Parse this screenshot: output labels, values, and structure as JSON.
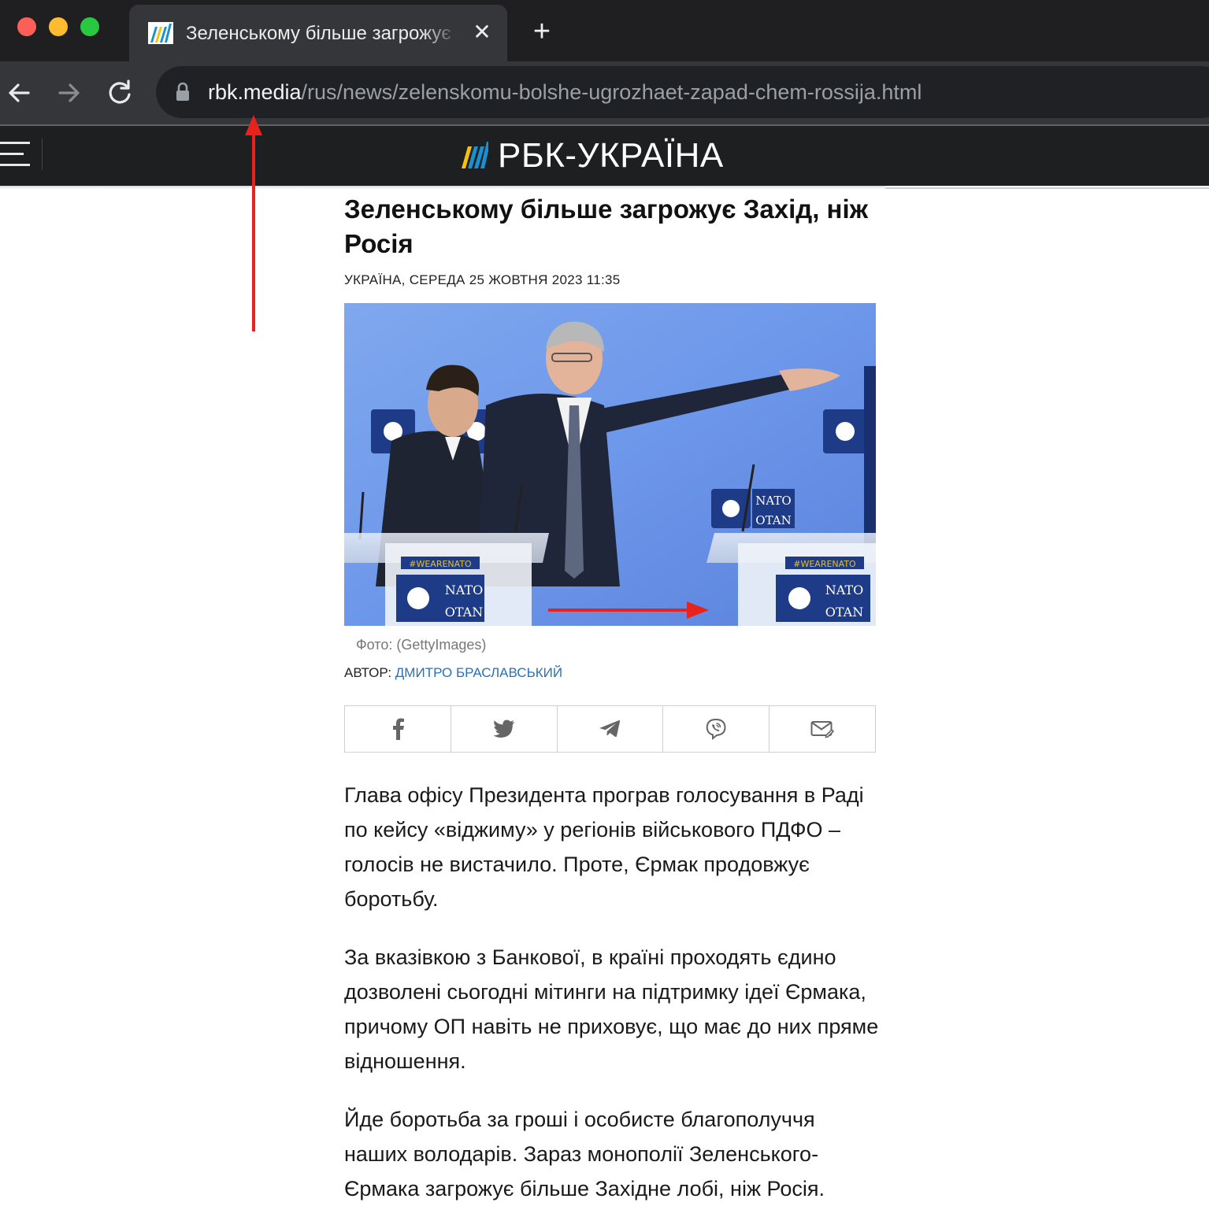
{
  "browser": {
    "tab_title": "Зеленському більше загрожує Захід, ніж Росія",
    "tab_close": "✕",
    "new_tab": "+",
    "url_domain": "rbk.media",
    "url_path": "/rus/news/zelenskomu-bolshe-ugrozhaet-zapad-chem-rossija.html"
  },
  "site": {
    "logo_text": "РБК-УКРАЇНА"
  },
  "article": {
    "headline": "Зеленському більше загрожує Захід, ніж Росія",
    "dateline": "УКРАЇНА, СЕРЕДА 25 ЖОВТНЯ 2023 11:35",
    "photo_caption": "Фото: (GettyImages)",
    "author_label": "АВТОР: ",
    "author_name": "ДМИТРО БРАСЛАВСЬКИЙ",
    "photo_podium_tag": "#WEARENATO",
    "photo_sign_line1": "NATO",
    "photo_sign_line2": "OTAN",
    "share_buttons": [
      "facebook-icon",
      "twitter-icon",
      "telegram-icon",
      "viber-icon",
      "mail-icon"
    ],
    "paragraphs": [
      "Глава офісу Президента програв голосування в Раді по кейсу «віджиму» у регіонів військового ПДФО – голосів не вистачило. Проте, Єрмак продовжує боротьбу.",
      "За вказівкою з Банкової, в країні проходять єдино дозволені сьогодні мітинги на підтримку ідеї Єрмака, причому ОП навіть не приховує, що має до них пряме відношення.",
      "Йде боротьба за гроші і особисте благополуччя наших володарів. Зараз монополії Зеленського-Єрмака загрожує більше Західне лобі, ніж Росія."
    ]
  },
  "colors": {
    "annotation_arrow": "#e8231d",
    "author_link": "#2771b9",
    "chrome_dark": "#1f1f21",
    "chrome_tab": "#35363a"
  }
}
